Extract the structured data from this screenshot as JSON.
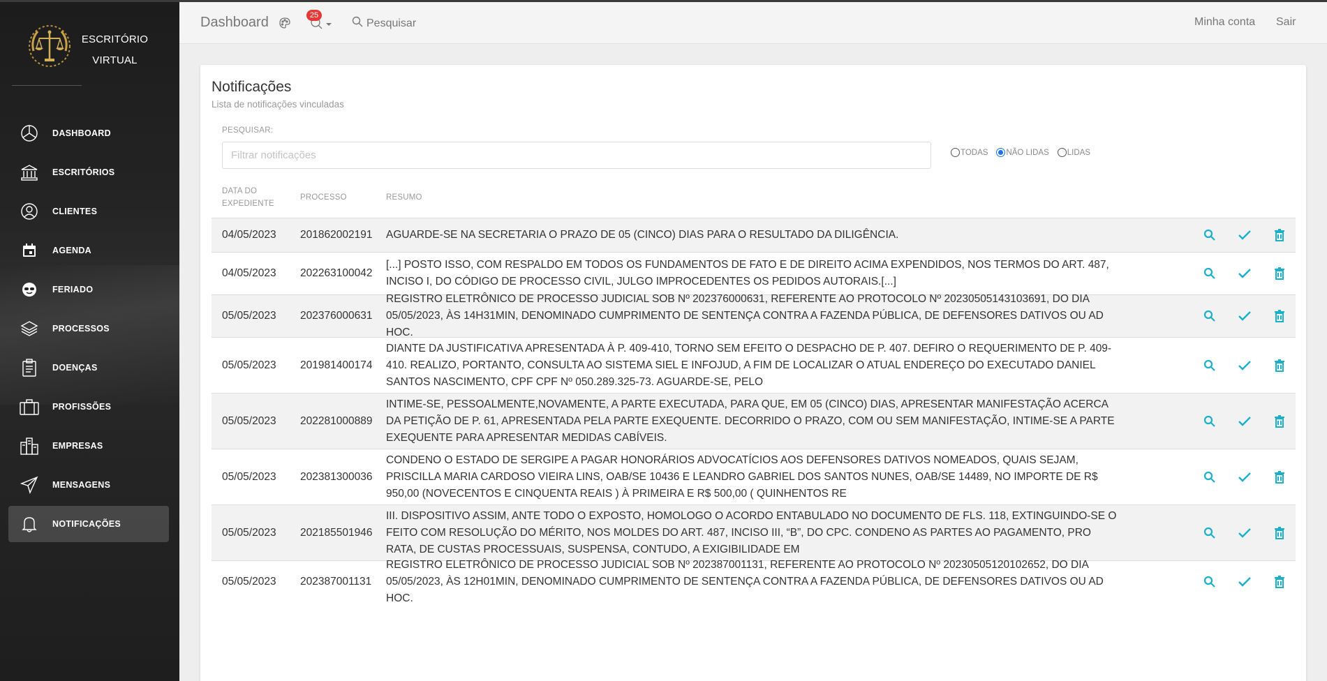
{
  "brand": {
    "line1": "ESCRITÓRIO",
    "line2": "VIRTUAL"
  },
  "sidebar": {
    "items": [
      {
        "label": "DASHBOARD",
        "icon": "pie-chart-icon"
      },
      {
        "label": "ESCRITÓRIOS",
        "icon": "bank-icon"
      },
      {
        "label": "CLIENTES",
        "icon": "user-icon"
      },
      {
        "label": "AGENDA",
        "icon": "calendar-icon"
      },
      {
        "label": "FERIADO",
        "icon": "sunglasses-icon"
      },
      {
        "label": "PROCESSOS",
        "icon": "layers-icon"
      },
      {
        "label": "DOENÇAS",
        "icon": "clipboard-icon"
      },
      {
        "label": "PROFISSÕES",
        "icon": "briefcase-icon"
      },
      {
        "label": "EMPRESAS",
        "icon": "buildings-icon"
      },
      {
        "label": "MENSAGENS",
        "icon": "paper-plane-icon"
      },
      {
        "label": "NOTIFICAÇÕES",
        "icon": "bell-icon",
        "active": true
      }
    ]
  },
  "topbar": {
    "title": "Dashboard",
    "badge": "25",
    "search_label": "Pesquisar",
    "account": "Minha conta",
    "logout": "Sair"
  },
  "card": {
    "title": "Notificações",
    "subtitle": "Lista de notificações vinculadas",
    "search_label": "PESQUISAR:",
    "search_placeholder": "Filtrar notificações",
    "filters": [
      {
        "label": "TODAS",
        "checked": false
      },
      {
        "label": "NÃO LIDAS",
        "checked": true
      },
      {
        "label": "LIDAS",
        "checked": false
      }
    ]
  },
  "table": {
    "headers": {
      "date_line1": "DATA DO",
      "date_line2": "EXPEDIENTE",
      "process": "PROCESSO",
      "summary": "RESUMO"
    },
    "rows": [
      {
        "date": "04/05/2023",
        "process": "201862002191",
        "summary": "AGUARDE-SE NA SECRETARIA O PRAZO DE 05 (CINCO) DIAS PARA O RESULTADO DA DILIGÊNCIA."
      },
      {
        "date": "04/05/2023",
        "process": "202263100042",
        "summary": "[...] POSTO ISSO, COM RESPALDO EM TODOS OS FUNDAMENTOS DE FATO E DE DIREITO ACIMA EXPENDIDOS, NOS TERMOS DO ART. 487, INCISO I, DO CÓDIGO DE PROCESSO CIVIL, JULGO IMPROCEDENTES OS PEDIDOS AUTORAIS.[...]"
      },
      {
        "date": "05/05/2023",
        "process": "202376000631",
        "summary": "REGISTRO ELETRÔNICO DE PROCESSO JUDICIAL SOB Nº 202376000631, REFERENTE AO PROTOCOLO Nº 20230505143103691, DO DIA 05/05/2023, ÀS 14H31MIN, DENOMINADO CUMPRIMENTO DE SENTENÇA CONTRA A FAZENDA PÚBLICA, DE DEFENSORES DATIVOS OU AD HOC."
      },
      {
        "date": "05/05/2023",
        "process": "201981400174",
        "summary": "DIANTE DA JUSTIFICATIVA APRESENTADA À P. 409-410, TORNO SEM EFEITO O DESPACHO DE P. 407. DEFIRO O REQUERIMENTO DE P. 409-410. REALIZO, PORTANTO, CONSULTA AO SISTEMA SIEL E INFOJUD, A FIM DE LOCALIZAR O ATUAL ENDEREÇO DO EXECUTADO DANIEL SANTOS NASCIMENTO, CPF CPF Nº 050.289.325-73. AGUARDE-SE, PELO"
      },
      {
        "date": "05/05/2023",
        "process": "202281000889",
        "summary": "INTIME-SE, PESSOALMENTE,NOVAMENTE, A PARTE EXECUTADA, PARA QUE, EM 05 (CINCO) DIAS, APRESENTAR MANIFESTAÇÃO ACERCA DA PETIÇÃO DE P. 61, APRESENTADA PELA PARTE EXEQUENTE. DECORRIDO O PRAZO, COM OU SEM MANIFESTAÇÃO, INTIME-SE A PARTE EXEQUENTE PARA APRESENTAR MEDIDAS CABÍVEIS."
      },
      {
        "date": "05/05/2023",
        "process": "202381300036",
        "summary": "CONDENO O ESTADO DE SERGIPE A PAGAR HONORÁRIOS ADVOCATÍCIOS AOS DEFENSORES DATIVOS NOMEADOS, QUAIS SEJAM, PRISCILLA MARIA CARDOSO VIEIRA LINS, OAB/SE 10436 E LEANDRO GABRIEL DOS SANTOS NUNES, OAB/SE 14489, NO IMPORTE DE R$ 950,00 (NOVECENTOS E CINQUENTA REAIS ) À PRIMEIRA E R$ 500,00 ( QUINHENTOS RE"
      },
      {
        "date": "05/05/2023",
        "process": "202185501946",
        "summary": "III. DISPOSITIVO ASSIM, ANTE TODO O EXPOSTO, HOMOLOGO O ACORDO ENTABULADO NO DOCUMENTO DE FLS. 118, EXTINGUINDO-SE O FEITO COM RESOLUÇÃO DO MÉRITO, NOS MOLDES DO ART. 487, INCISO III, “B”, DO CPC. CONDENO AS PARTES AO PAGAMENTO, PRO RATA, DE CUSTAS PROCESSUAIS, SUSPENSA, CONTUDO, A EXIGIBILIDADE EM"
      },
      {
        "date": "05/05/2023",
        "process": "202387001131",
        "summary": "REGISTRO ELETRÔNICO DE PROCESSO JUDICIAL SOB Nº 202387001131, REFERENTE AO PROTOCOLO Nº 20230505120102652, DO DIA 05/05/2023, ÀS 12H01MIN, DENOMINADO CUMPRIMENTO DE SENTENÇA CONTRA A FAZENDA PÚBLICA, DE DEFENSORES DATIVOS OU AD HOC."
      }
    ]
  },
  "colors": {
    "accent": "#1ab0c8",
    "sidebar_bg": "#222222",
    "badge": "#e53935"
  }
}
